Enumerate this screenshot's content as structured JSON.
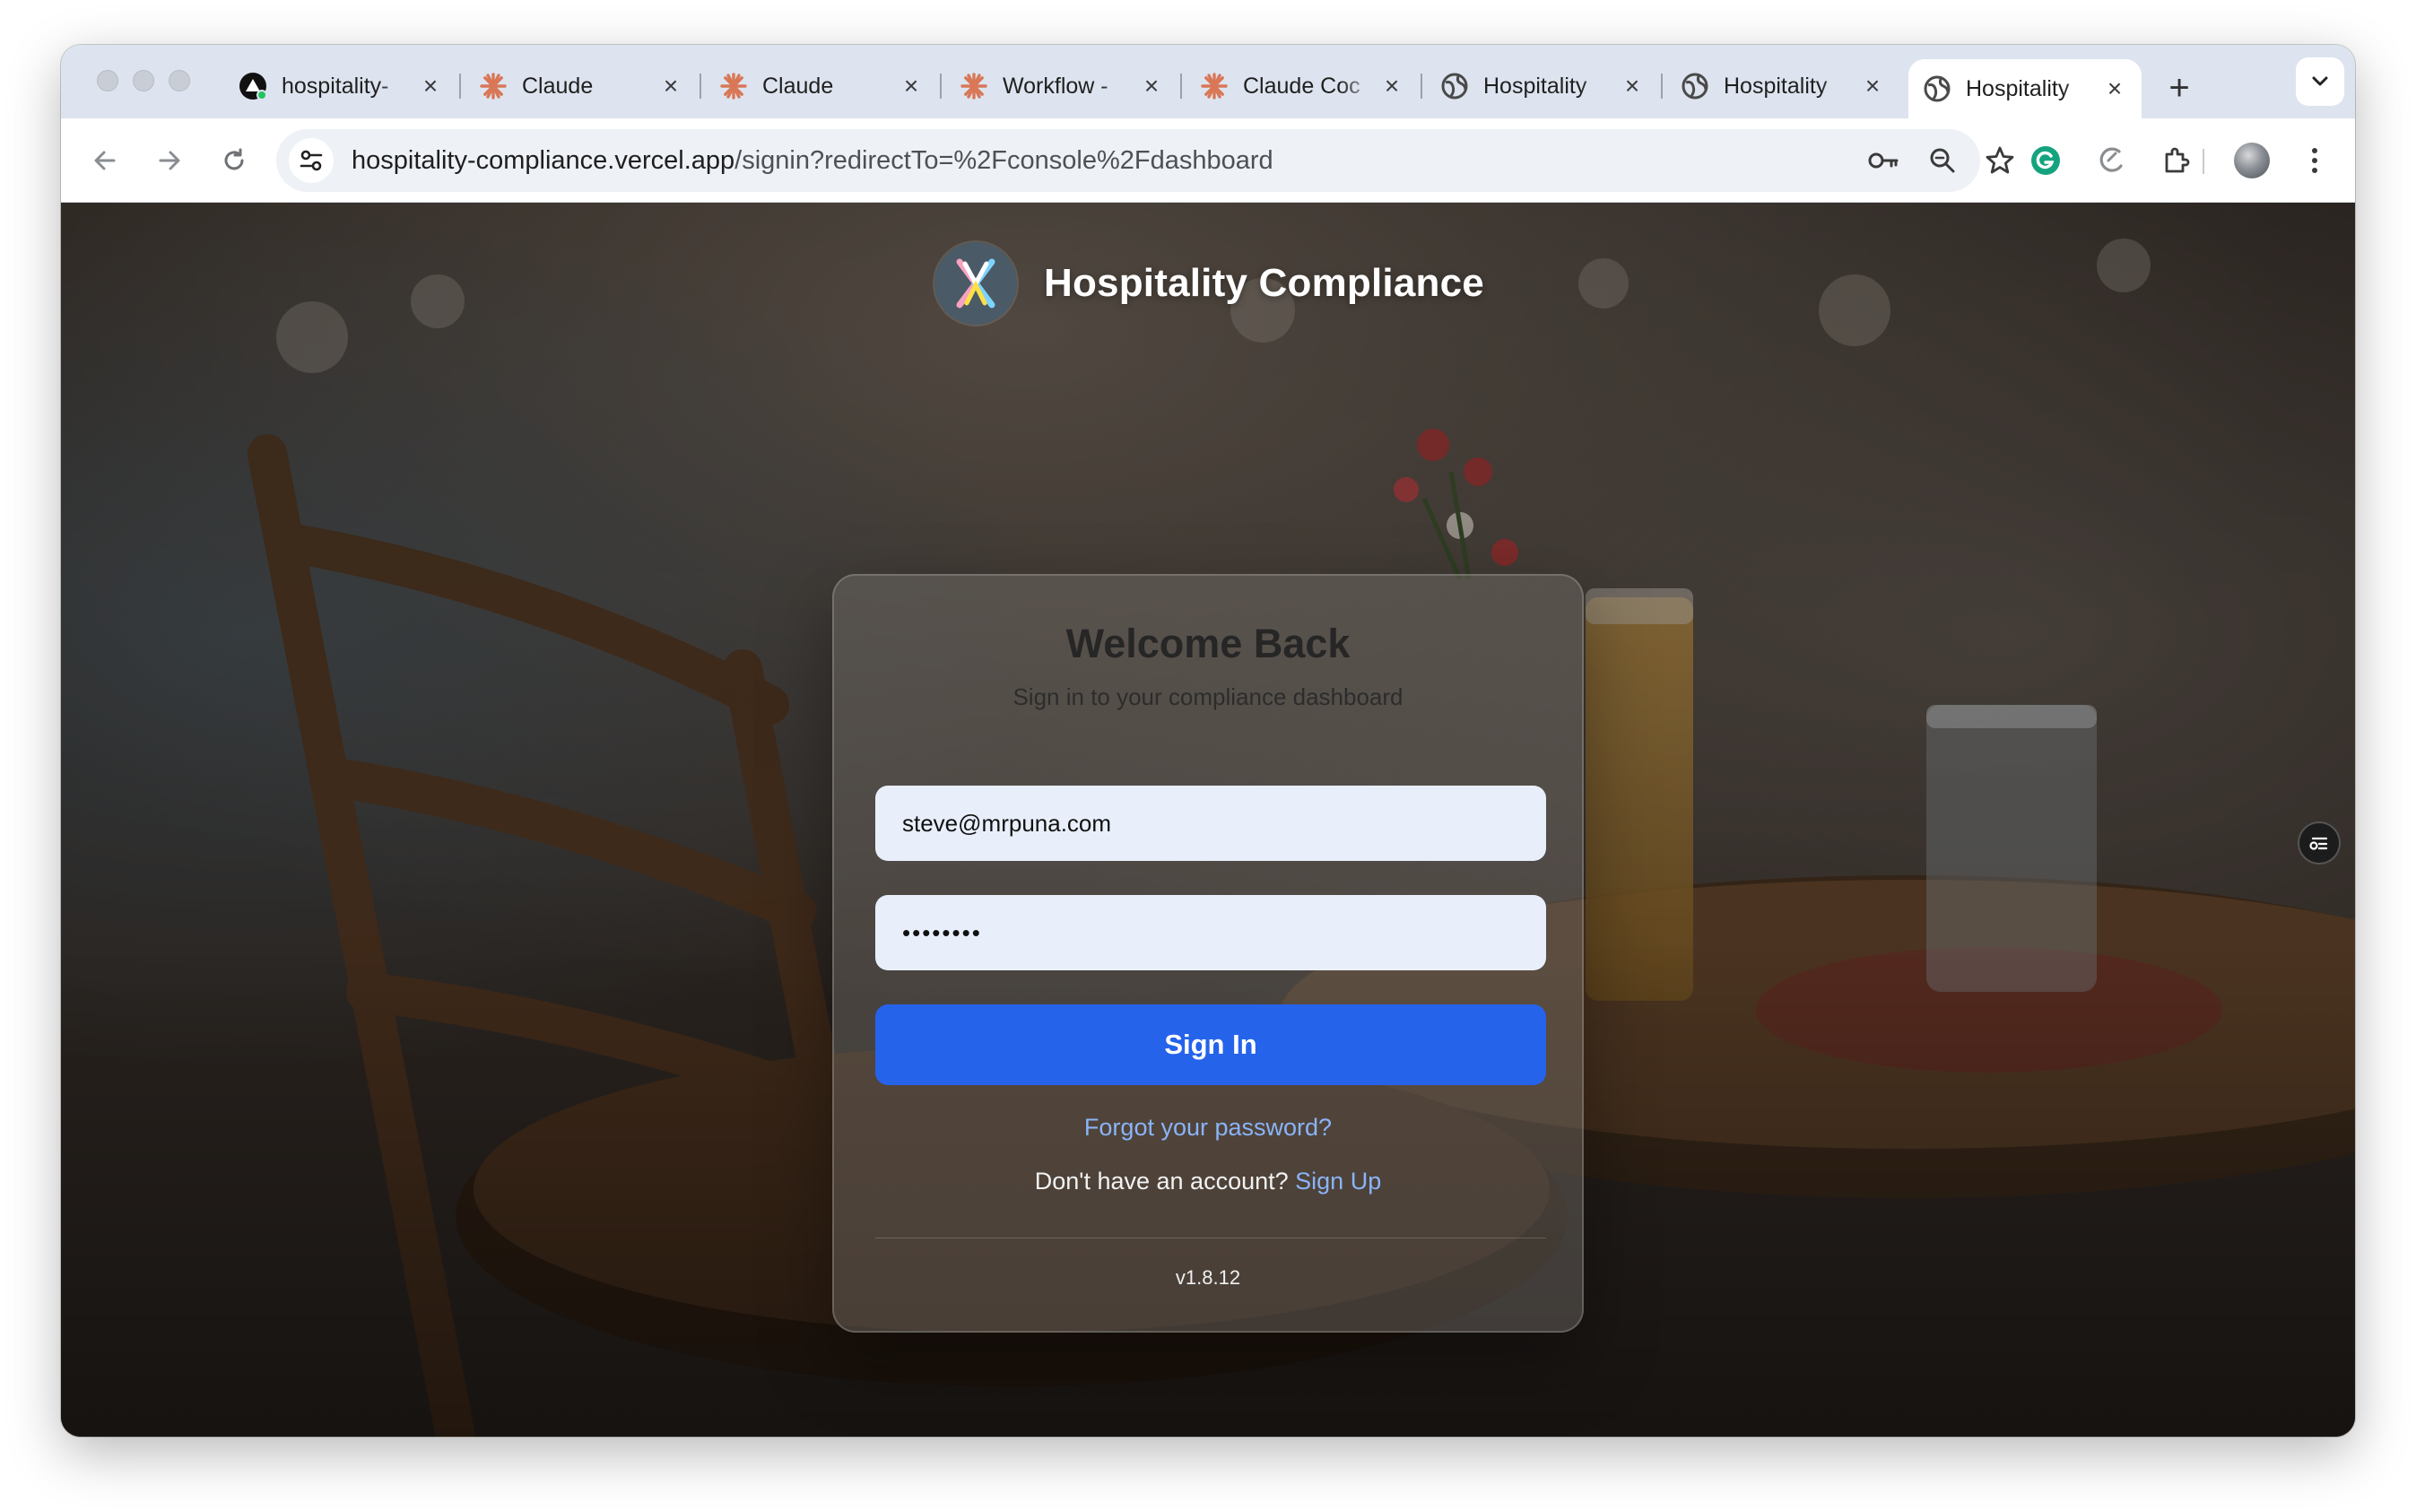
{
  "browser": {
    "tabs": [
      {
        "title": "hospitality-",
        "icon": "vercel-icon",
        "active": false
      },
      {
        "title": "Claude",
        "icon": "claude-icon",
        "active": false
      },
      {
        "title": "Claude",
        "icon": "claude-icon",
        "active": false
      },
      {
        "title": "Workflow -",
        "icon": "claude-icon",
        "active": false
      },
      {
        "title": "Claude Coc",
        "icon": "claude-icon",
        "active": false
      },
      {
        "title": "Hospitality",
        "icon": "globe-icon",
        "active": false
      },
      {
        "title": "Hospitality",
        "icon": "globe-icon",
        "active": false
      },
      {
        "title": "Hospitality",
        "icon": "globe-icon",
        "active": true
      }
    ],
    "url_host": "hospitality-compliance.vercel.app",
    "url_path": "/signin?redirectTo=%2Fconsole%2Fdashboard",
    "colors": {
      "accent": "#2563eb",
      "link": "#8ab4f8",
      "claude": "#d97757"
    }
  },
  "brand": {
    "name": "Hospitality Compliance"
  },
  "signin": {
    "title": "Welcome Back",
    "subtitle": "Sign in to your compliance dashboard",
    "email_value": "steve@mrpuna.com",
    "password_value": "••••••••",
    "submit_label": "Sign In",
    "forgot_label": "Forgot your password?",
    "no_account_text": "Don't have an account?",
    "signup_label": "Sign Up",
    "version": "v1.8.12"
  }
}
